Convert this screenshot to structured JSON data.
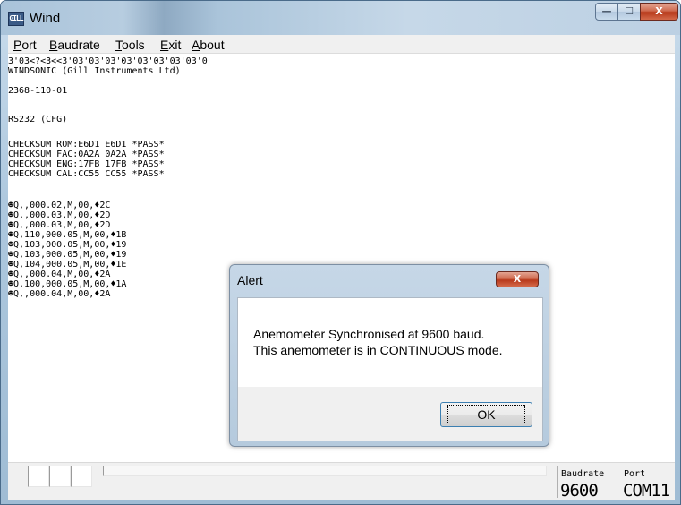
{
  "window": {
    "title": "Wind",
    "app_icon_text": "GILL",
    "minimize_glyph": "—",
    "maximize_glyph": "☐",
    "close_glyph": "X"
  },
  "menu": {
    "items": [
      {
        "label": "Port"
      },
      {
        "label": "Baudrate"
      },
      {
        "label": "Tools"
      },
      {
        "label": "Exit"
      },
      {
        "label": "About"
      }
    ]
  },
  "console": {
    "lines": [
      "3'03<?<3<<3'03'03'03'03'03'03'03'03'0",
      "WINDSONIC (Gill Instruments Ltd)",
      "",
      "2368-110-01",
      "",
      "RS232 (CFG)",
      "",
      "CHECKSUM ROM:E6D1 E6D1 *PASS*",
      "CHECKSUM FAC:0A2A 0A2A *PASS*",
      "CHECKSUM ENG:17FB 17FB *PASS*",
      "CHECKSUM CAL:CC55 CC55 *PASS*",
      "",
      "☻Q,,000.02,M,00,♦2C",
      "☻Q,,000.03,M,00,♦2D",
      "☻Q,,000.03,M,00,♦2D",
      "☻Q,110,000.05,M,00,♦1B",
      "☻Q,103,000.05,M,00,♦19",
      "☻Q,103,000.05,M,00,♦19",
      "☻Q,104,000.05,M,00,♦1E",
      "☻Q,,000.04,M,00,♦2A",
      "☻Q,100,000.05,M,00,♦1A",
      "☻Q,,000.04,M,00,♦2A"
    ]
  },
  "status": {
    "baudrate_label": "Baudrate",
    "baudrate_value": "9600",
    "port_label": "Port",
    "port_value": "COM11"
  },
  "alert": {
    "title": "Alert",
    "close_glyph": "X",
    "message_line1": "Anemometer Synchronised at 9600 baud.",
    "message_line2": "This anemometer is in CONTINUOUS mode.",
    "ok_label": "OK"
  }
}
